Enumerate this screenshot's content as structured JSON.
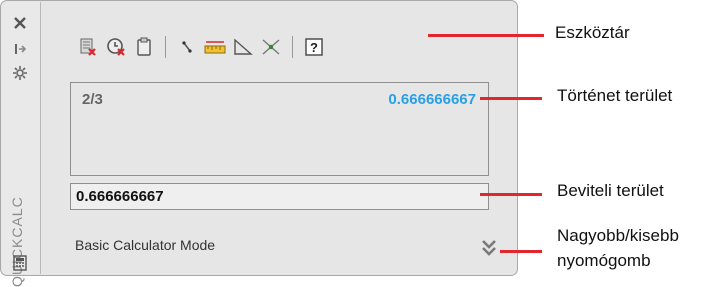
{
  "palette": {
    "title": "QUICKCALC",
    "history": {
      "expression": "2/3",
      "result": "0.666666667"
    },
    "input": {
      "value": "0.666666667"
    },
    "mode_label": "Basic Calculator Mode"
  },
  "callouts": {
    "toolbar": "Eszköztár",
    "history": "Történet terület",
    "input": "Beviteli terület",
    "toggle_line1": "Nagyobb/kisebb",
    "toggle_line2": "nyomógomb"
  },
  "colors": {
    "accent": "#e3252d",
    "result": "#29a0e6"
  },
  "icons": {
    "strip": [
      "close-icon",
      "auto-hide-icon",
      "properties-icon",
      "calculator-icon"
    ],
    "toolbar": [
      "clear-icon",
      "clear-history-icon",
      "paste-icon",
      "get-coordinates-icon",
      "distance-icon",
      "angle-icon",
      "intersection-icon",
      "help-icon"
    ],
    "toggle": "double-chevron-down-icon"
  }
}
